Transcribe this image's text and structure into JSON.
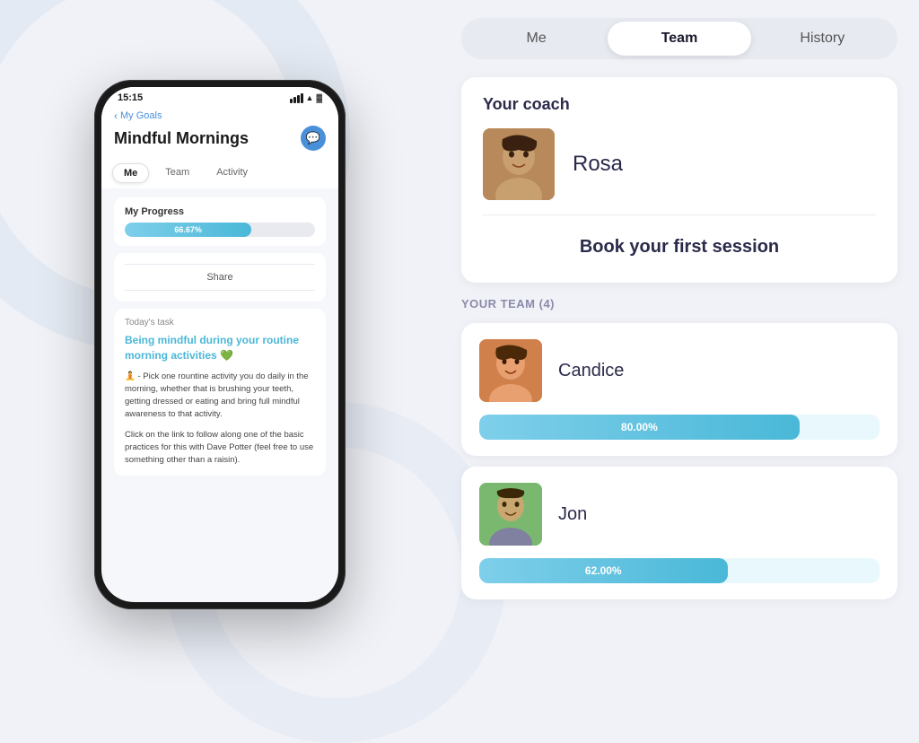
{
  "app": {
    "background_color": "#f0f2f7"
  },
  "phone": {
    "status_bar": {
      "time": "15:15",
      "signal": "●●●●",
      "wifi": "wifi",
      "battery": "battery"
    },
    "back_nav": {
      "label": "My Goals",
      "icon": "‹"
    },
    "title": "Mindful Mornings",
    "tabs": [
      {
        "label": "Me",
        "active": true
      },
      {
        "label": "Team",
        "active": false
      },
      {
        "label": "Activity",
        "active": false
      }
    ],
    "progress": {
      "label": "My Progress",
      "value": 66.67,
      "display": "66.67%"
    },
    "share": {
      "label": "Share"
    },
    "task": {
      "label": "Today's task",
      "title": "Being mindful during your routine morning activities 💚",
      "body1": "🧘 - Pick one rountine activity you do daily in the morning, whether that is brushing your teeth, getting dressed or eating and bring full mindful awareness to that activity.",
      "body2": "Click on the link to follow along one of the basic practices for this with Dave Potter (feel free to use something other than a raisin)."
    }
  },
  "right": {
    "tabs": [
      {
        "label": "Me",
        "active": false
      },
      {
        "label": "Team",
        "active": true
      },
      {
        "label": "History",
        "active": false
      }
    ],
    "coach_section": {
      "label": "Your coach",
      "coach_name": "Rosa",
      "book_session": "Book your first session"
    },
    "team_section": {
      "label": "YOUR TEAM (4)",
      "members": [
        {
          "name": "Candice",
          "progress": 80.0,
          "display": "80.00%",
          "avatar_emoji": "😄"
        },
        {
          "name": "Jon",
          "progress": 62.0,
          "display": "62.00%",
          "avatar_emoji": "🙂"
        }
      ]
    }
  }
}
